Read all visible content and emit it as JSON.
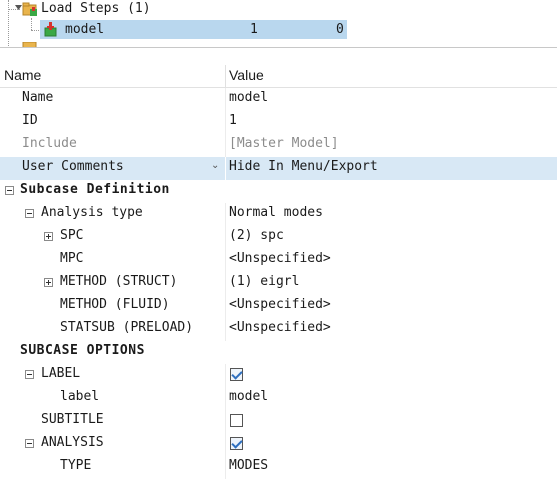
{
  "tree": {
    "load_steps_label": "Load Steps (1)",
    "selected_item": {
      "name": "model",
      "col1": "1",
      "col2": "0"
    },
    "more_indicator": "..."
  },
  "grid_header": {
    "name": "Name",
    "value": "Value"
  },
  "rows": [
    {
      "label": "Name",
      "value": "model"
    },
    {
      "label": "ID",
      "value": "1"
    },
    {
      "label": "Include",
      "value": "[Master Model]"
    },
    {
      "label": "User Comments",
      "value": "Hide In Menu/Export"
    },
    {
      "label": "Subcase Definition"
    },
    {
      "label": "Analysis type",
      "value": "Normal modes"
    },
    {
      "label": "SPC",
      "value": "(2) spc"
    },
    {
      "label": "MPC",
      "value": "<Unspecified>"
    },
    {
      "label": "METHOD (STRUCT)",
      "value": "(1) eigrl"
    },
    {
      "label": "METHOD (FLUID)",
      "value": "<Unspecified>"
    },
    {
      "label": "STATSUB (PRELOAD)",
      "value": "<Unspecified>"
    },
    {
      "label": "SUBCASE OPTIONS"
    },
    {
      "label": "LABEL",
      "checked": true
    },
    {
      "label": "label",
      "value": "model"
    },
    {
      "label": "SUBTITLE",
      "checked": false
    },
    {
      "label": "ANALYSIS",
      "checked": true
    },
    {
      "label": "TYPE",
      "value": "MODES"
    }
  ],
  "colors": {
    "selection": "#b9d7ee",
    "row_highlight": "#d8e8f5",
    "check": "#2e6fbf"
  },
  "icons": {
    "load_step": "load-step-icon",
    "subcase": "subcase-icon"
  }
}
